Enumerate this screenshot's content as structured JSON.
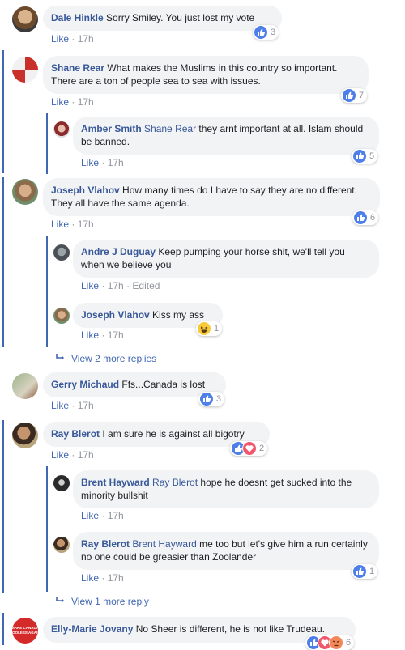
{
  "like_label": "Like",
  "separator": "·",
  "comments": [
    {
      "name": "Dale Hinkle",
      "mention": "",
      "text": "Sorry Smiley. You just lost my vote",
      "time": "17h",
      "edited": "",
      "reaction_count": "3"
    },
    {
      "name": "Shane Rear",
      "mention": "",
      "text": "What makes the Muslims in this country so important. There are a ton of people sea to sea with issues.",
      "time": "17h",
      "edited": "",
      "reaction_count": "7"
    },
    {
      "name": "Amber Smith",
      "mention": "Shane Rear",
      "text": "they arnt important at all. Islam should be banned.",
      "time": "17h",
      "edited": "",
      "reaction_count": "5"
    },
    {
      "name": "Joseph Vlahov",
      "mention": "",
      "text": "How many times do I have to say they are no different. They all have the same agenda.",
      "time": "17h",
      "edited": "",
      "reaction_count": "6"
    },
    {
      "name": "Andre J Duguay",
      "mention": "",
      "text": "Keep pumping your horse shit, we'll tell you when we believe you",
      "time": "17h",
      "edited": "Edited",
      "reaction_count": ""
    },
    {
      "name": "Joseph Vlahov",
      "mention": "",
      "text": "Kiss my ass",
      "time": "17h",
      "edited": "",
      "reaction_count": "1"
    },
    {
      "name": "Gerry Michaud",
      "mention": "",
      "text": "Ffs...Canada is lost",
      "time": "17h",
      "edited": "",
      "reaction_count": "3"
    },
    {
      "name": "Ray Blerot",
      "mention": "",
      "text": "I am sure he is against all bigotry",
      "time": "17h",
      "edited": "",
      "reaction_count": "2"
    },
    {
      "name": "Brent Hayward",
      "mention": "Ray Blerot",
      "text": "hope he doesnt get sucked into the minority bullshit",
      "time": "17h",
      "edited": "",
      "reaction_count": ""
    },
    {
      "name": "Ray Blerot",
      "mention": "Brent Hayward",
      "text": "me too but let's give him a run certainly no one could be greasier than Zoolander",
      "time": "17h",
      "edited": "",
      "reaction_count": "1"
    },
    {
      "name": "Elly-Marie Jovany",
      "mention": "",
      "text": "No Sheer is different, he is not like Trudeau.",
      "time": "",
      "edited": "",
      "reaction_count": "6"
    }
  ],
  "view_more": [
    "View 2 more replies",
    "View 1 more reply"
  ],
  "avatar_badge_text": "MAKE CANADA TOOLESS AGAIN",
  "colors": {
    "link": "#385898",
    "like": "#4267b2",
    "bubble": "#f2f3f5",
    "meta": "#90949c",
    "thread_line": "#4267b2"
  },
  "icons": [
    "like-icon",
    "love-icon",
    "haha-icon",
    "angry-icon",
    "reply-arrow-icon"
  ]
}
